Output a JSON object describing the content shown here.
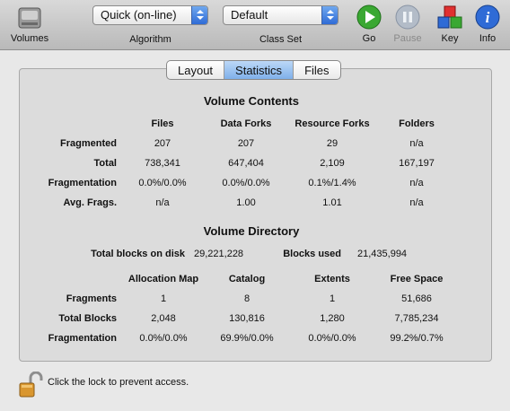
{
  "toolbar": {
    "volumes_label": "Volumes",
    "algorithm": {
      "value": "Quick (on-line)",
      "label": "Algorithm"
    },
    "class_set": {
      "value": "Default",
      "label": "Class Set"
    },
    "go_label": "Go",
    "pause_label": "Pause",
    "key_label": "Key",
    "info_label": "Info"
  },
  "tabs": [
    {
      "label": "Layout",
      "active": false
    },
    {
      "label": "Statistics",
      "active": true
    },
    {
      "label": "Files",
      "active": false
    }
  ],
  "volume_contents": {
    "title": "Volume Contents",
    "columns": [
      "Files",
      "Data Forks",
      "Resource Forks",
      "Folders"
    ],
    "rows": [
      {
        "label": "Fragmented",
        "values": [
          "207",
          "207",
          "29",
          "n/a"
        ]
      },
      {
        "label": "Total",
        "values": [
          "738,341",
          "647,404",
          "2,109",
          "167,197"
        ]
      },
      {
        "label": "Fragmentation",
        "values": [
          "0.0%/0.0%",
          "0.0%/0.0%",
          "0.1%/1.4%",
          "n/a"
        ]
      },
      {
        "label": "Avg. Frags.",
        "values": [
          "n/a",
          "1.00",
          "1.01",
          "n/a"
        ]
      }
    ]
  },
  "volume_directory": {
    "title": "Volume Directory",
    "total_blocks_label": "Total blocks on disk",
    "total_blocks_value": "29,221,228",
    "blocks_used_label": "Blocks used",
    "blocks_used_value": "21,435,994",
    "columns": [
      "Allocation Map",
      "Catalog",
      "Extents",
      "Free Space"
    ],
    "rows": [
      {
        "label": "Fragments",
        "values": [
          "1",
          "8",
          "1",
          "51,686"
        ]
      },
      {
        "label": "Total Blocks",
        "values": [
          "2,048",
          "130,816",
          "1,280",
          "7,785,234"
        ]
      },
      {
        "label": "Fragmentation",
        "values": [
          "0.0%/0.0%",
          "69.9%/0.0%",
          "0.0%/0.0%",
          "99.2%/0.7%"
        ]
      }
    ]
  },
  "footer": {
    "lock_text": "Click the lock to prevent access."
  },
  "colors": {
    "tab_active": "#7fb0ea",
    "go": "#3aa832",
    "info": "#2f6bd6"
  }
}
